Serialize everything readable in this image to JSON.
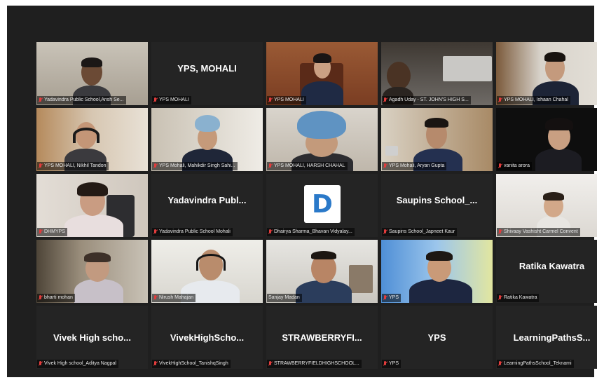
{
  "accent_active": "#b5d23a",
  "mic_muted_color": "#e23c3c",
  "tiles": [
    {
      "label": "Yadavindra Public School,Ansh Se..."
    },
    {
      "name": "YPS, MOHALI",
      "label": "YPS MOHALI"
    },
    {
      "label": "YPS MOHALI"
    },
    {
      "label": "Agadh Uday - ST. JOHN'S HIGH S..."
    },
    {
      "label": "YPS MOHALI, Ishaan Chahal"
    },
    {
      "label": "YPS MOHALI, Nikhil Tandon"
    },
    {
      "label": "YPS Mohali, Mahikdir Singh Sahi..."
    },
    {
      "label": "YPS MOHALI, HARSH CHAHAL"
    },
    {
      "label": "YPS Mohali, Aryan Gupta"
    },
    {
      "label": "vanita arora"
    },
    {
      "label": "DHMYPS"
    },
    {
      "name": "Yadavindra Publ...",
      "label": "Yadavindra Public School Mohali"
    },
    {
      "logo": "D",
      "label": "Dhairya Sharma_Bhavan Vidyalay..."
    },
    {
      "name": "Saupins School_...",
      "label": "Saupins School_Japneet Kaur"
    },
    {
      "label": "Shivaay Vashisht Carmel Convent"
    },
    {
      "label": "bharti mohan"
    },
    {
      "label": "Nirush Mahajan"
    },
    {
      "label": "Sanjay Madan"
    },
    {
      "label": "YPS"
    },
    {
      "name": "Ratika Kawatra",
      "label": "Ratika Kawatra"
    },
    {
      "name": "Vivek High scho...",
      "label": "Vivek High school_Aditya Nagpal"
    },
    {
      "name": "VivekHighScho...",
      "label": "VivekHighSchool_TanishqSingh"
    },
    {
      "name": "STRAWBERRYFI...",
      "label": "STRAWBERRYFIELDHIGHSCHOOL..."
    },
    {
      "name": "YPS",
      "label": "YPS"
    },
    {
      "name": "LearningPathsS...",
      "label": "LearningPathsSchool_Teknami"
    }
  ]
}
